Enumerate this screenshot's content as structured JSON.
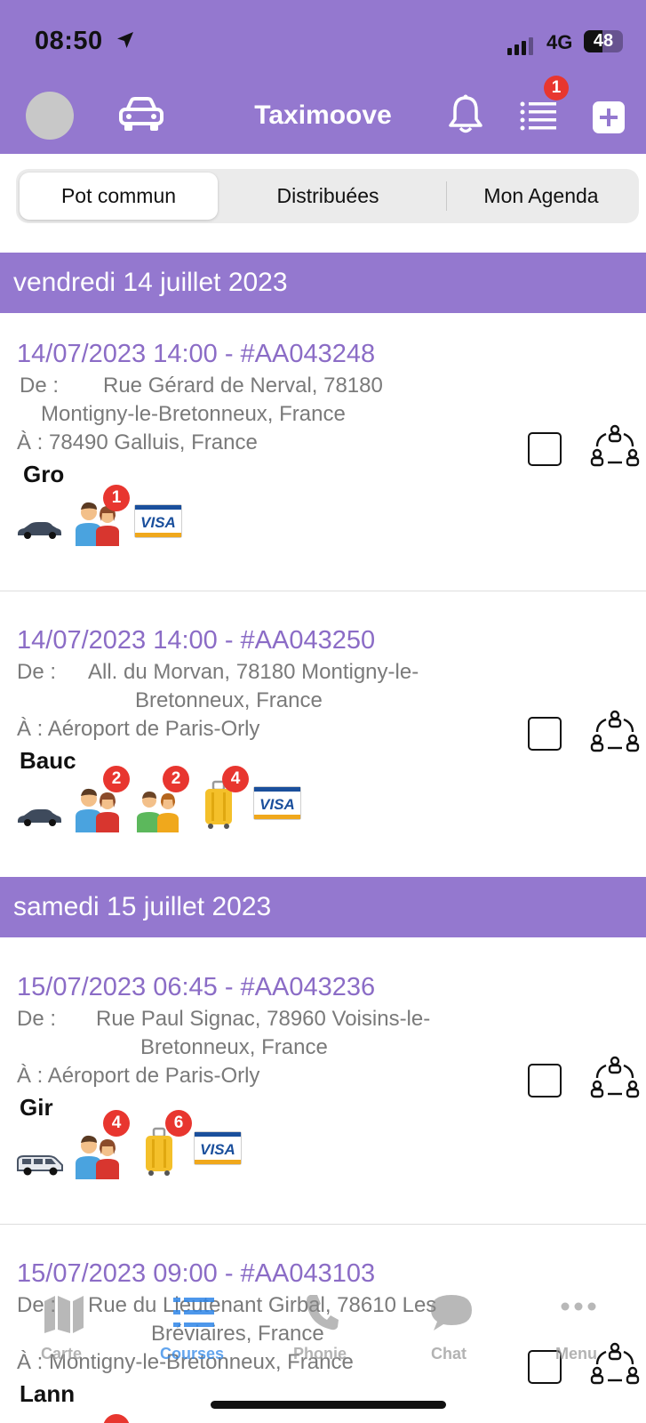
{
  "status_bar": {
    "time": "08:50",
    "network": "4G",
    "battery": "48",
    "battery_level": 0.48
  },
  "header": {
    "title": "Taximoove",
    "list_badge": "1"
  },
  "tabs": [
    {
      "label": "Pot commun",
      "active": true
    },
    {
      "label": "Distribuées",
      "active": false
    },
    {
      "label": "Mon Agenda",
      "active": false
    }
  ],
  "days": [
    {
      "label": "vendredi 14 juillet 2023"
    },
    {
      "label": "samedi 15 juillet 2023"
    }
  ],
  "rides": [
    {
      "title": "14/07/2023 14:00 - #AA043248",
      "from_label": "De :",
      "from_1": "Rue Gérard de Nerval, 78180",
      "from_2": "Montigny-le-Bretonneux, France",
      "to": "À : 78490 Galluis, France",
      "client": "Gro",
      "vehicle": "sedan",
      "passenger_groups": [
        "1"
      ],
      "luggage": null,
      "payment": "VISA"
    },
    {
      "title": "14/07/2023 14:00 - #AA043250",
      "from_label": "De :",
      "from_1": "All. du Morvan, 78180 Montigny-le-",
      "from_2": "Bretonneux, France",
      "to": "À : Aéroport de Paris-Orly",
      "client": "Bauc",
      "vehicle": "sedan",
      "passenger_groups": [
        "2",
        "2"
      ],
      "luggage": "4",
      "payment": "VISA"
    },
    {
      "title": "15/07/2023 06:45 - #AA043236",
      "from_label": "De :",
      "from_1": "Rue Paul Signac, 78960 Voisins-le-",
      "from_2": "Bretonneux, France",
      "to": "À : Aéroport de Paris-Orly",
      "client": "Gir",
      "vehicle": "van",
      "passenger_groups": [
        "4"
      ],
      "luggage": "6",
      "payment": "VISA"
    },
    {
      "title": "15/07/2023 09:00 - #AA043103",
      "from_label": "De :",
      "from_1": "Rue du Lieutenant Girbal, 78610 Les",
      "from_2": "Bréviaires, France",
      "to": "À : Montigny-le-Bretonneux, France",
      "client": "Lann"
    }
  ],
  "bottom_nav": [
    {
      "label": "Carte",
      "icon": "map-icon",
      "active": false
    },
    {
      "label": "Courses",
      "icon": "list-icon",
      "active": true
    },
    {
      "label": "Phonie",
      "icon": "phone-icon",
      "active": false
    },
    {
      "label": "Chat",
      "icon": "chat-icon",
      "active": false
    },
    {
      "label": "Menu",
      "icon": "more-icon",
      "active": false
    }
  ],
  "colors": {
    "primary": "#9478cf",
    "title_text": "#8b6cc6",
    "badge": "#e8362f",
    "active_tab": "#2e86e8"
  }
}
